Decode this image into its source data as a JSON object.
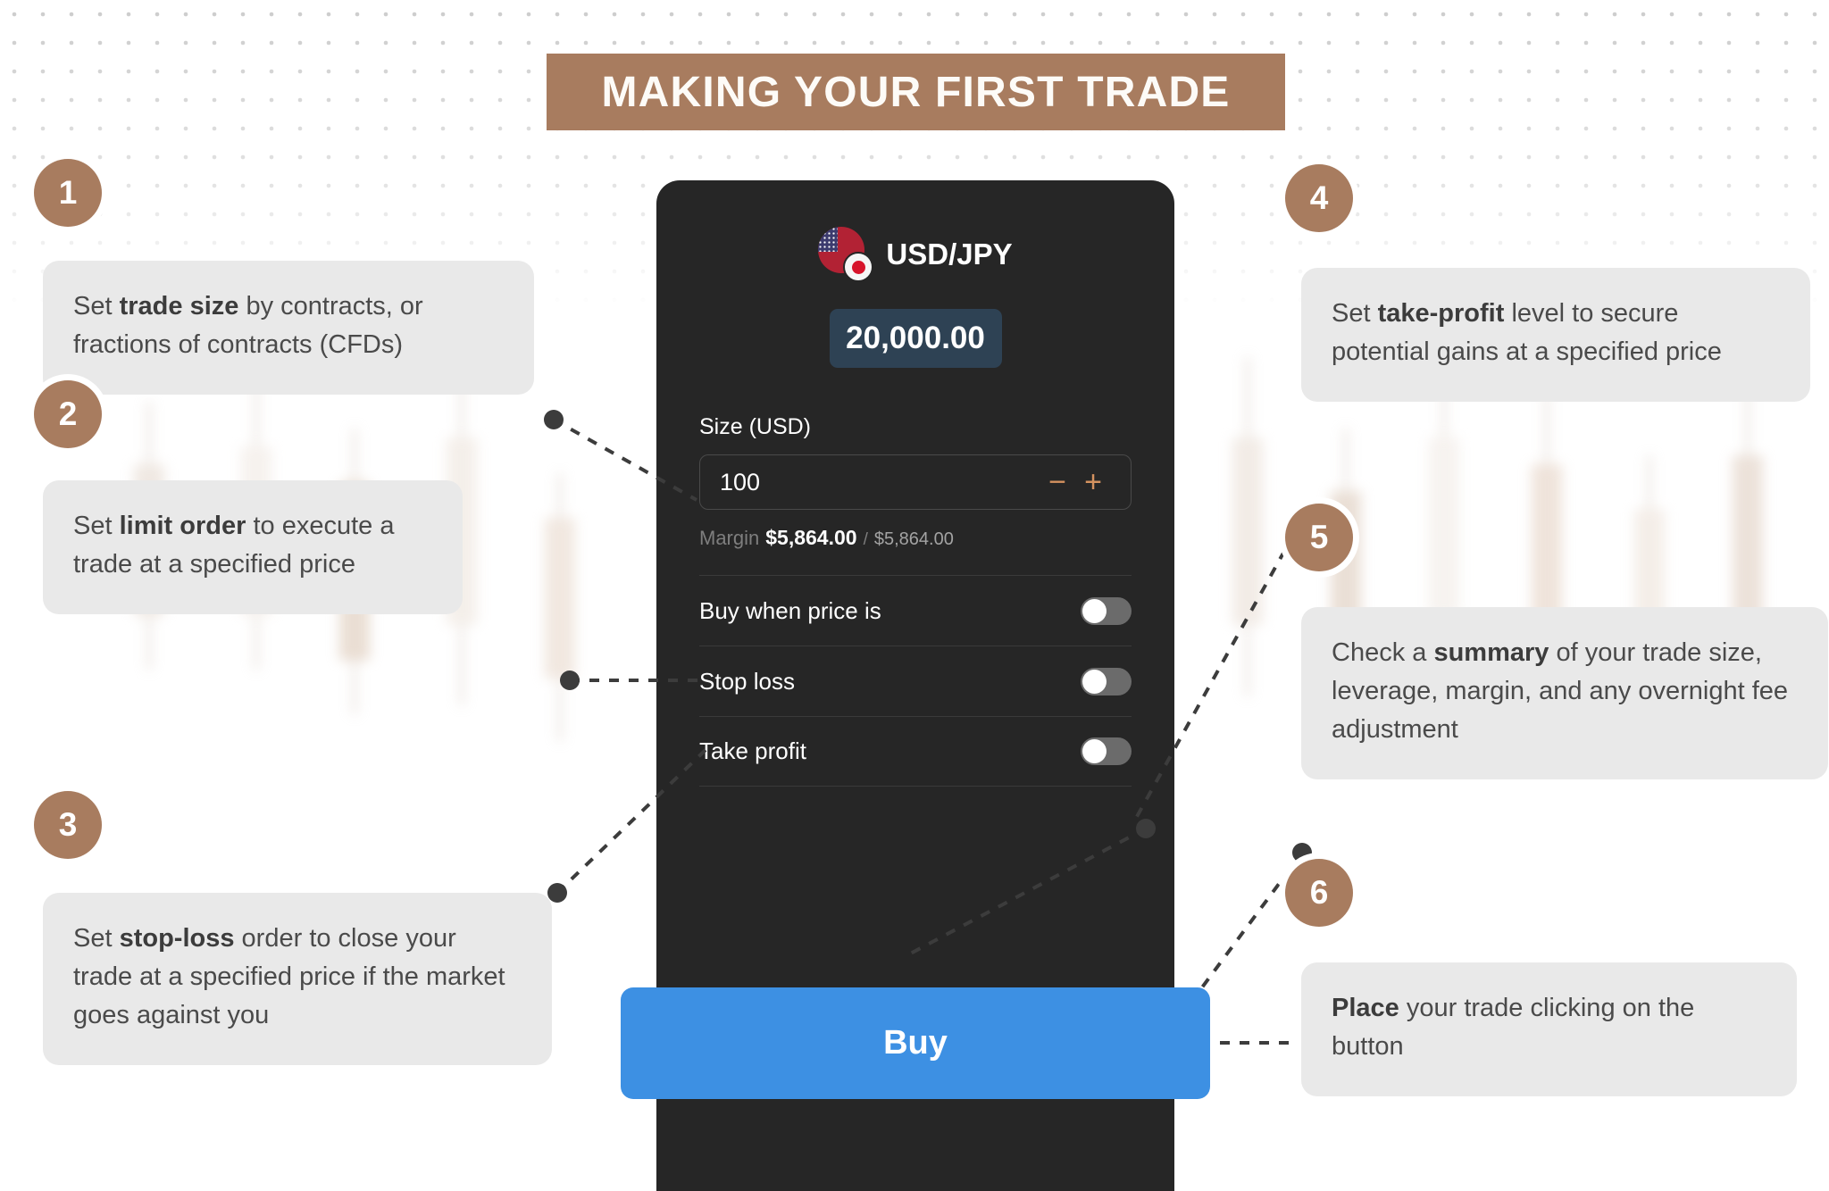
{
  "header": {
    "title": "MAKING YOUR FIRST TRADE",
    "banner_color": "#a87c5f"
  },
  "trade_panel": {
    "pair": "USD/JPY",
    "flag_left": "us-flag-icon",
    "flag_right": "jp-flag-icon",
    "price": "20,000.00",
    "price_chip_color": "#2e4254",
    "size_label": "Size (USD)",
    "size_value": "100",
    "decrement": "−",
    "increment": "+",
    "stepper_color": "#d4925f",
    "margin_label": "Margin",
    "margin_used": "$5,864.00",
    "margin_separator": "/",
    "margin_total": "$5,864.00",
    "toggles": [
      {
        "label": "Buy when price is",
        "state": "off"
      },
      {
        "label": "Stop loss",
        "state": "off"
      },
      {
        "label": "Take profit",
        "state": "off"
      }
    ],
    "buy_label": "Buy",
    "buy_color": "#3d90e3"
  },
  "callouts": [
    {
      "number": "1",
      "text_html": "Set <b>trade size</b> by contracts, or fractions of contracts (CFDs)",
      "plain": "Set trade size by contracts, or fractions of contracts (CFDs)"
    },
    {
      "number": "2",
      "text_html": "Set <b>limit order</b> to execute a trade at a specified price",
      "plain": "Set limit order to execute a trade at a specified price"
    },
    {
      "number": "3",
      "text_html": "Set <b>stop-loss</b> order to close your trade at a specified price if the market goes against you",
      "plain": "Set stop-loss order to close your trade at a specified price if the market goes against you"
    },
    {
      "number": "4",
      "text_html": "Set <b>take-profit</b> level to secure potential gains at a specified price",
      "plain": "Set take-profit level to secure potential gains at a specified price"
    },
    {
      "number": "5",
      "text_html": "Check a <b>summary</b> of your trade size, leverage, margin, and any overnight fee adjustment",
      "plain": "Check a summary of your trade size, leverage, margin, and any overnight fee adjustment"
    },
    {
      "number": "6",
      "text_html": "<b>Place</b> your trade clicking on the button",
      "plain": "Place your trade clicking on the button"
    }
  ],
  "theme": {
    "badge_color": "#a87c5f",
    "callout_bg": "#e9e9e9",
    "panel_bg": "#262626",
    "connector_color": "#3c3c3c"
  }
}
